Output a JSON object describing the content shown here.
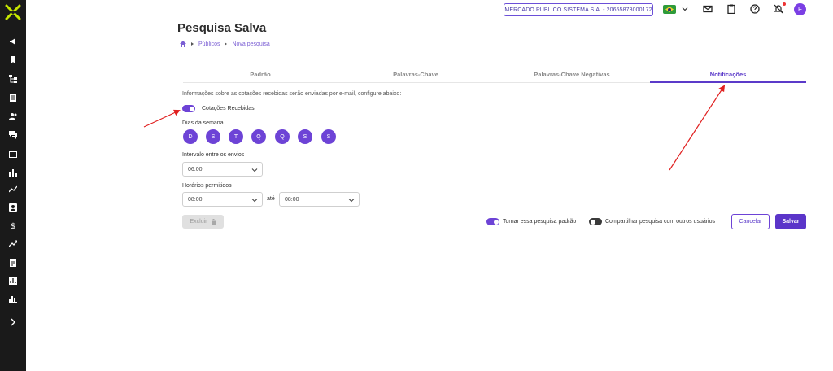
{
  "header": {
    "company": "MERCADO PUBLICO SISTEMA S.A. - 20655878000172",
    "avatar_initial": "F"
  },
  "page": {
    "title": "Pesquisa Salva",
    "breadcrumb": [
      "Públicos",
      "Nova pesquisa"
    ]
  },
  "tabs": [
    {
      "label": "Padrão",
      "active": false
    },
    {
      "label": "Palavras-Chave",
      "active": false
    },
    {
      "label": "Palavras-Chave Negativas",
      "active": false
    },
    {
      "label": "Notificações",
      "active": true
    }
  ],
  "notifications": {
    "info": "Informações sobre as cotações recebidas serão enviadas por e-mail, configure abaixo:",
    "toggle_label": "Cotações Recebidas",
    "toggle_on": true,
    "days_label": "Dias da semana",
    "days": [
      "D",
      "S",
      "T",
      "Q",
      "Q",
      "S",
      "S"
    ],
    "interval_label": "Intervalo entre os envios",
    "interval_value": "06:00",
    "hours_label": "Horários permitidos",
    "hours_from": "08:00",
    "hours_sep": "até",
    "hours_to": "08:00"
  },
  "footer": {
    "delete_label": "Excluir",
    "default_toggle_label": "Tornar essa pesquisa padrão",
    "default_toggle_on": true,
    "share_toggle_label": "Compartilhar pesquisa com outros usuários",
    "share_toggle_on": false,
    "cancel_label": "Cancelar",
    "save_label": "Salvar"
  },
  "colors": {
    "accent": "#5b3ac9",
    "sidebar": "#1a1a1a",
    "annotation_arrow": "#e02020"
  }
}
